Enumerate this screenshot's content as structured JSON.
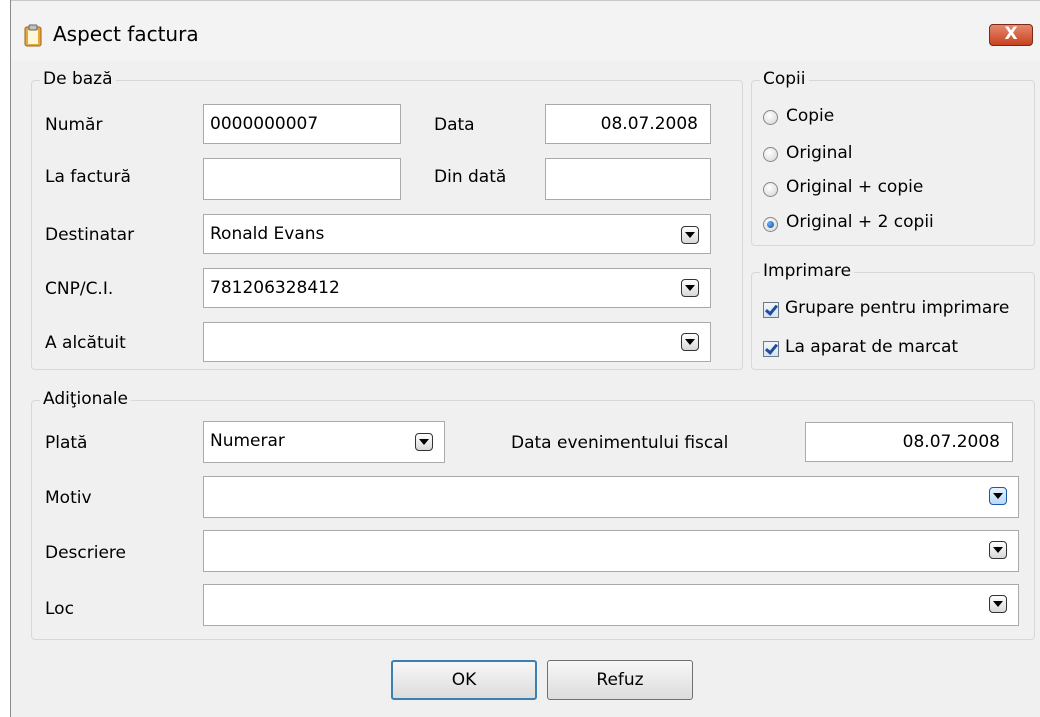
{
  "window": {
    "title": "Aspect factura",
    "close_label": "X"
  },
  "de_baza": {
    "title": "De bază",
    "numar_label": "Număr",
    "numar_value": "0000000007",
    "data_label": "Data",
    "data_value": "08.07.2008",
    "la_factura_label": "La factură",
    "la_factura_value": "",
    "din_data_label": "Din dată",
    "din_data_value": "",
    "destinatar_label": "Destinatar",
    "destinatar_value": "Ronald Evans",
    "cnp_label": "CNP/C.I.",
    "cnp_value": "781206328412",
    "a_alcatuit_label": "A alcătuit",
    "a_alcatuit_value": ""
  },
  "copii": {
    "title": "Copii",
    "options": [
      "Copie",
      "Original",
      "Original + copie",
      "Original + 2 copii"
    ],
    "selected": "Original + 2 copii"
  },
  "imprimare": {
    "title": "Imprimare",
    "grupare_label": "Grupare pentru imprimare",
    "grupare_checked": true,
    "aparat_label": "La aparat de marcat",
    "aparat_checked": true
  },
  "aditionale": {
    "title": "Adiţionale",
    "plata_label": "Plată",
    "plata_value": "Numerar",
    "data_fiscal_label": "Data evenimentului fiscal",
    "data_fiscal_value": "08.07.2008",
    "motiv_label": "Motiv",
    "motiv_value": "",
    "descriere_label": "Descriere",
    "descriere_value": "",
    "loc_label": "Loc",
    "loc_value": ""
  },
  "buttons": {
    "ok": "OK",
    "refuz": "Refuz"
  },
  "colors": {
    "dialog_bg": "#f0f0f0",
    "close_red": "#c8401f",
    "accent_blue": "#1c5aa8"
  }
}
